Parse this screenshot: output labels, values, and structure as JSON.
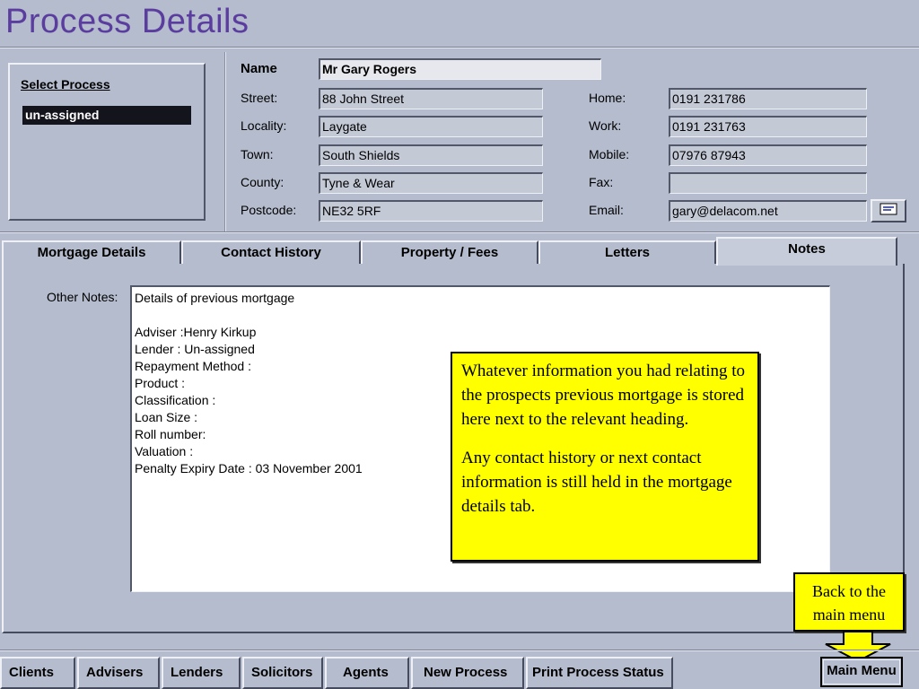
{
  "window": {
    "title": "Process Details"
  },
  "select_process": {
    "title": "Select Process",
    "items": [
      "un-assigned"
    ]
  },
  "contact": {
    "name_label": "Name",
    "name_value": "Mr Gary Rogers",
    "address": [
      {
        "label": "Street:",
        "value": "88 John Street"
      },
      {
        "label": "Locality:",
        "value": "Laygate"
      },
      {
        "label": "Town:",
        "value": "South Shields"
      },
      {
        "label": "County:",
        "value": "Tyne & Wear"
      },
      {
        "label": "Postcode:",
        "value": "NE32 5RF"
      }
    ],
    "phones": [
      {
        "label": "Home:",
        "value": "0191 231786"
      },
      {
        "label": "Work:",
        "value": "0191 231763"
      },
      {
        "label": "Mobile:",
        "value": "07976 87943"
      },
      {
        "label": "Fax:",
        "value": ""
      },
      {
        "label": "Email:",
        "value": "gary@delacom.net"
      }
    ],
    "email_button_icon": "envelope-icon"
  },
  "tabs": [
    {
      "label": "Mortgage Details",
      "active": false
    },
    {
      "label": "Contact History",
      "active": false
    },
    {
      "label": "Property / Fees",
      "active": false
    },
    {
      "label": "Letters",
      "active": false
    },
    {
      "label": "Notes",
      "active": true
    }
  ],
  "notes": {
    "label": "Other Notes:",
    "text": "Details of previous mortgage\n\nAdviser :Henry Kirkup\nLender : Un-assigned\nRepayment Method :\nProduct :\nClassification :\nLoan Size :\nRoll number:\nValuation :\nPenalty Expiry Date : 03 November 2001"
  },
  "callouts": {
    "info_p1": "Whatever information you had relating to the prospects previous mortgage is stored here next to the relevant heading.",
    "info_p2": "Any contact history or next contact information is still held in the mortgage details tab.",
    "back": "Back to the main menu"
  },
  "bottom_nav": [
    "Clients",
    "Advisers",
    "Lenders",
    "Solicitors",
    "Agents",
    "New Process",
    "Print Process Status"
  ],
  "main_menu_label": "Main Menu",
  "colors": {
    "title": "#5a3d9e",
    "background": "#b4bccd",
    "callout": "#ffff00",
    "arrow": "#ffff00"
  }
}
